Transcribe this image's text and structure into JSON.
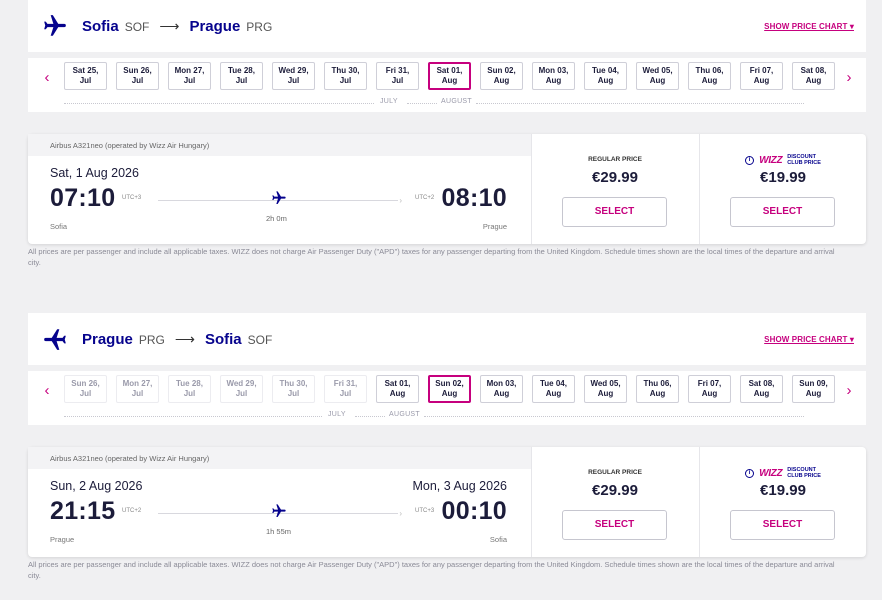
{
  "legs": [
    {
      "origin_city": "Sofia",
      "origin_code": "SOF",
      "destination_city": "Prague",
      "destination_code": "PRG",
      "route_arrow": "⟶",
      "show_price_chart": "SHOW PRICE CHART ▾",
      "dates": [
        {
          "day": "Sat 25,",
          "month": "Jul",
          "state": "normal"
        },
        {
          "day": "Sun 26,",
          "month": "Jul",
          "state": "normal"
        },
        {
          "day": "Mon 27,",
          "month": "Jul",
          "state": "normal"
        },
        {
          "day": "Tue 28,",
          "month": "Jul",
          "state": "normal"
        },
        {
          "day": "Wed 29,",
          "month": "Jul",
          "state": "normal"
        },
        {
          "day": "Thu 30,",
          "month": "Jul",
          "state": "normal"
        },
        {
          "day": "Fri 31,",
          "month": "Jul",
          "state": "normal"
        },
        {
          "day": "Sat 01,",
          "month": "Aug",
          "state": "selected"
        },
        {
          "day": "Sun 02,",
          "month": "Aug",
          "state": "normal"
        },
        {
          "day": "Mon 03,",
          "month": "Aug",
          "state": "normal"
        },
        {
          "day": "Tue 04,",
          "month": "Aug",
          "state": "normal"
        },
        {
          "day": "Wed 05,",
          "month": "Aug",
          "state": "normal"
        },
        {
          "day": "Thu 06,",
          "month": "Aug",
          "state": "normal"
        },
        {
          "day": "Fri 07,",
          "month": "Aug",
          "state": "normal"
        },
        {
          "day": "Sat 08,",
          "month": "Aug",
          "state": "normal"
        }
      ],
      "month_left": "JULY",
      "month_right": "AUGUST",
      "aircraft": "Airbus A321neo (operated by Wizz Air Hungary)",
      "departure_date": "Sat, 1 Aug 2026",
      "arrival_date": "",
      "departure_time": "07:10",
      "departure_utc": "UTC+3",
      "arrival_time": "08:10",
      "arrival_utc": "UTC+2",
      "departure_city": "Sofia",
      "arrival_city": "Prague",
      "duration": "2h 0m",
      "regular_label": "REGULAR PRICE",
      "regular_price": "€29.99",
      "club_brand": "WIZZ",
      "club_line1": "DISCOUNT",
      "club_line2": "CLUB PRICE",
      "club_price": "€19.99",
      "select_label": "SELECT"
    },
    {
      "origin_city": "Prague",
      "origin_code": "PRG",
      "destination_city": "Sofia",
      "destination_code": "SOF",
      "route_arrow": "⟶",
      "show_price_chart": "SHOW PRICE CHART ▾",
      "dates": [
        {
          "day": "Sun 26,",
          "month": "Jul",
          "state": "dim"
        },
        {
          "day": "Mon 27,",
          "month": "Jul",
          "state": "dim"
        },
        {
          "day": "Tue 28,",
          "month": "Jul",
          "state": "dim"
        },
        {
          "day": "Wed 29,",
          "month": "Jul",
          "state": "dim"
        },
        {
          "day": "Thu 30,",
          "month": "Jul",
          "state": "dim"
        },
        {
          "day": "Fri 31,",
          "month": "Jul",
          "state": "dim"
        },
        {
          "day": "Sat 01,",
          "month": "Aug",
          "state": "normal"
        },
        {
          "day": "Sun 02,",
          "month": "Aug",
          "state": "selected"
        },
        {
          "day": "Mon 03,",
          "month": "Aug",
          "state": "normal"
        },
        {
          "day": "Tue 04,",
          "month": "Aug",
          "state": "normal"
        },
        {
          "day": "Wed 05,",
          "month": "Aug",
          "state": "normal"
        },
        {
          "day": "Thu 06,",
          "month": "Aug",
          "state": "normal"
        },
        {
          "day": "Fri 07,",
          "month": "Aug",
          "state": "normal"
        },
        {
          "day": "Sat 08,",
          "month": "Aug",
          "state": "normal"
        },
        {
          "day": "Sun 09,",
          "month": "Aug",
          "state": "normal"
        }
      ],
      "month_left": "JULY",
      "month_right": "AUGUST",
      "aircraft": "Airbus A321neo (operated by Wizz Air Hungary)",
      "departure_date": "Sun, 2 Aug 2026",
      "arrival_date": "Mon, 3 Aug 2026",
      "departure_time": "21:15",
      "departure_utc": "UTC+2",
      "arrival_time": "00:10",
      "arrival_utc": "UTC+3",
      "departure_city": "Prague",
      "arrival_city": "Sofia",
      "duration": "1h 55m",
      "regular_label": "REGULAR PRICE",
      "regular_price": "€29.99",
      "club_brand": "WIZZ",
      "club_line1": "DISCOUNT",
      "club_line2": "CLUB PRICE",
      "club_price": "€19.99",
      "select_label": "SELECT"
    }
  ],
  "disclaimer": "All prices are per passenger and include all applicable taxes. WIZZ does not charge Air Passenger Duty (\"APD\") taxes for any passenger departing from the United Kingdom. Schedule times shown are the local times of the departure and arrival city.",
  "nav": {
    "prev": "‹",
    "next": "›"
  },
  "colors": {
    "brand_blue": "#06038d",
    "brand_magenta": "#c6007e"
  },
  "icons": {
    "route": "plane-icon",
    "flight": "plane-icon",
    "info": "info-icon",
    "prev": "chevron-left-icon",
    "next": "chevron-right-icon"
  }
}
